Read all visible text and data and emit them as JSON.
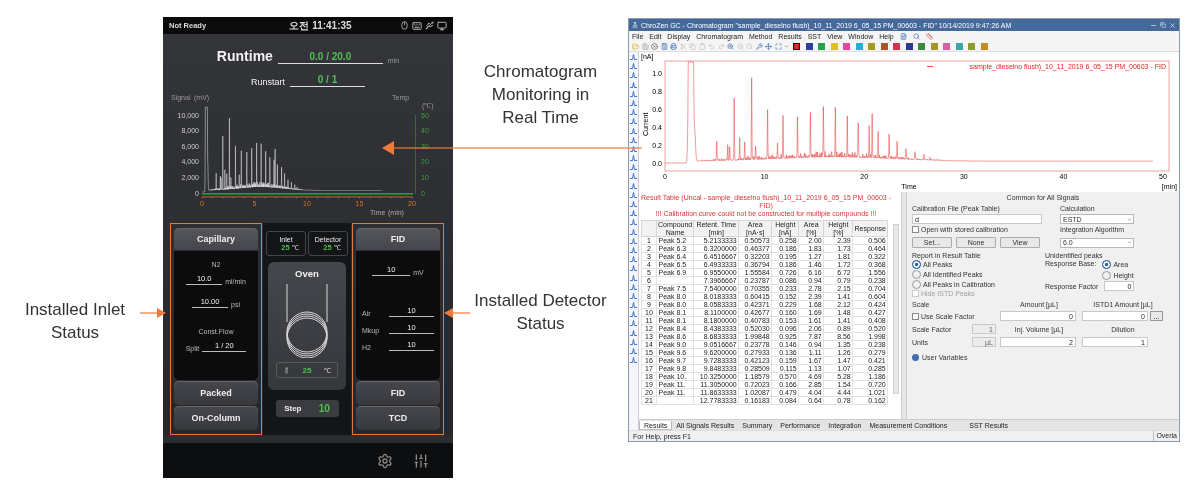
{
  "callouts": {
    "monitoring": "Chromatogram Monitoring in Real Time",
    "inlet": "Installed Inlet Status",
    "detector": "Installed Detector Status"
  },
  "device": {
    "status_bar": {
      "state": "Not Ready",
      "clock": "오전 11:41:35"
    },
    "runtime": {
      "label": "Runtime",
      "value": "0.0 / 20.0",
      "unit": "min"
    },
    "runstart": {
      "label": "Runstart",
      "value": "0 / 1"
    },
    "chart": {
      "left_title": "Signal",
      "left_unit": "(mV)",
      "right_title": "Temp",
      "right_unit": "(℃)",
      "left_ticks": [
        "10,000",
        "8,000",
        "6,000",
        "4,000",
        "2,000",
        "0"
      ],
      "right_ticks": [
        "50",
        "40",
        "30",
        "20",
        "10",
        "0"
      ],
      "x_ticks": [
        "0",
        "5",
        "10",
        "15",
        "20"
      ],
      "x_title": "Time",
      "x_unit": "(min)"
    },
    "inlet": {
      "types": [
        {
          "label": "Capillary",
          "selected": true
        },
        {
          "label": "Packed",
          "selected": false
        },
        {
          "label": "On-Column",
          "selected": false
        }
      ],
      "gas": "N2",
      "flow": "10.0",
      "flow_unit": "ml/min",
      "pressure": "10.00",
      "pressure_unit": "psi",
      "mode": "Const.Flow",
      "split_label": "Split",
      "split": "1 / 20"
    },
    "temps": [
      {
        "label": "Inlet",
        "value": "25",
        "unit": "℃"
      },
      {
        "label": "Detector",
        "value": "25",
        "unit": "℃"
      }
    ],
    "oven": {
      "label": "Oven",
      "value": "25",
      "unit": "℃"
    },
    "step": {
      "label": "Step",
      "value": "10"
    },
    "detector": {
      "types": [
        {
          "label": "FID",
          "selected": true
        },
        {
          "label": "FID",
          "selected": false
        },
        {
          "label": "TCD",
          "selected": false
        }
      ],
      "signal": "10",
      "signal_unit": "mV",
      "gases": [
        {
          "label": "Air",
          "value": "10"
        },
        {
          "label": "Mkup",
          "value": "10"
        },
        {
          "label": "H2",
          "value": "10"
        }
      ]
    }
  },
  "app": {
    "title": "ChroZen GC - Chromatogram \"sample_dieselno flush)_10_11_2019 6_05_15 PM_00603 - FID\" 10/14/2019 9:47:26 AM",
    "menu": [
      "File",
      "Edit",
      "Display",
      "Chromatogram",
      "Method",
      "Results",
      "SST",
      "View",
      "Window",
      "Help"
    ],
    "palette": [
      {
        "color": "#e32424",
        "selected": true
      },
      {
        "color": "#2b3f9e",
        "selected": false
      },
      {
        "color": "#23a34a",
        "selected": false
      },
      {
        "color": "#e0c21e",
        "selected": false
      },
      {
        "color": "#e0489e",
        "selected": false
      },
      {
        "color": "#22b0d6",
        "selected": false
      },
      {
        "color": "#a39a22",
        "selected": false
      },
      {
        "color": "#a8552a",
        "selected": false
      },
      {
        "color": "#d2344e",
        "selected": false
      },
      {
        "color": "#2f3890",
        "selected": false
      },
      {
        "color": "#3c8a3c",
        "selected": false
      },
      {
        "color": "#a8922e",
        "selected": false
      },
      {
        "color": "#d45fa4",
        "selected": false
      },
      {
        "color": "#3ea4a8",
        "selected": false
      },
      {
        "color": "#8e9a32",
        "selected": false
      },
      {
        "color": "#c58a24",
        "selected": false
      }
    ],
    "chart": {
      "y_unit": "[nA]",
      "y_title": "Current",
      "yticks": [
        "1.0",
        "0.8",
        "0.6",
        "0.4",
        "0.2",
        "0.0"
      ],
      "xticks": [
        "0",
        "10",
        "20",
        "30",
        "40",
        "50"
      ],
      "x_title": "Time",
      "x_unit": "[min]",
      "legend": "sample_dieselno flush)_10_11_2019 6_05_15 PM_00603 - FID"
    },
    "results": {
      "title": "Result Table (Uncal - sample_dieselno flush)_10_11_2019 6_05_15 PM_00603 - FID)",
      "warning": "!!! Calibration curve could not be constructed for multiple compounds !!!",
      "columns": [
        "Compound Name",
        "Retent. Time [min]",
        "Area [nA·s]",
        "Height [nA]",
        "Area [%]",
        "Height [%]",
        "Response"
      ],
      "rows": [
        {
          "no": "1",
          "name": "Peak 5.2",
          "values": [
            "5.2133333",
            "0.50573",
            "0.258",
            "2.00",
            "2.39",
            "0.506"
          ]
        },
        {
          "no": "2",
          "name": "Peak 6.3",
          "values": [
            "6.3200000",
            "0.46377",
            "0.186",
            "1.83",
            "1.73",
            "0.464"
          ]
        },
        {
          "no": "3",
          "name": "Peak 6.4",
          "values": [
            "6.4516667",
            "0.32203",
            "0.195",
            "1.27",
            "1.81",
            "0.322"
          ]
        },
        {
          "no": "4",
          "name": "Peak 6.5",
          "values": [
            "6.4933333",
            "0.36794",
            "0.186",
            "1.46",
            "1.72",
            "0.368"
          ]
        },
        {
          "no": "5",
          "name": "Peak 6.9",
          "values": [
            "6.9550000",
            "1.55584",
            "0.726",
            "6.16",
            "6.72",
            "1.556"
          ]
        },
        {
          "no": "6",
          "values": [
            "7.3966667",
            "0.23787",
            "0.086",
            "0.94",
            "0.79",
            "0.238"
          ]
        },
        {
          "no": "7",
          "name": "Peak 7.5",
          "values": [
            "7.5400000",
            "0.70355",
            "0.233",
            "2.78",
            "2.15",
            "0.704"
          ]
        },
        {
          "no": "8",
          "name": "Peak 8.0",
          "values": [
            "8.0183333",
            "0.60415",
            "0.152",
            "2.39",
            "1.41",
            "0.604"
          ]
        },
        {
          "no": "9",
          "name": "Peak 8.0",
          "values": [
            "8.0583333",
            "0.42371",
            "0.229",
            "1.68",
            "2.12",
            "0.424"
          ]
        },
        {
          "no": "10",
          "name": "Peak 8.1",
          "values": [
            "8.1100000",
            "0.42677",
            "0.160",
            "1.69",
            "1.48",
            "0.427"
          ]
        },
        {
          "no": "11",
          "name": "Peak 8.1",
          "values": [
            "8.1800000",
            "0.40783",
            "0.153",
            "1.61",
            "1.41",
            "0.408"
          ]
        },
        {
          "no": "12",
          "name": "Peak 8.4",
          "values": [
            "8.4383333",
            "0.52030",
            "0.096",
            "2.06",
            "0.89",
            "0.520"
          ]
        },
        {
          "no": "13",
          "name": "Peak 8.6",
          "values": [
            "8.6833333",
            "1.99848",
            "0.925",
            "7.87",
            "8.56",
            "1.998"
          ]
        },
        {
          "no": "14",
          "name": "Peak 9.0",
          "values": [
            "9.0516667",
            "0.23778",
            "0.146",
            "0.94",
            "1.35",
            "0.238"
          ]
        },
        {
          "no": "15",
          "name": "Peak 9.6",
          "values": [
            "9.6200000",
            "0.27933",
            "0.136",
            "1.11",
            "1.26",
            "0.279"
          ]
        },
        {
          "no": "16",
          "name": "Peak 9.7",
          "values": [
            "9.7283333",
            "0.42123",
            "0.159",
            "1.67",
            "1.47",
            "0.421"
          ]
        },
        {
          "no": "17",
          "name": "Peak 9.8",
          "values": [
            "9.8483333",
            "0.28509",
            "0.115",
            "1.13",
            "1.07",
            "0.285"
          ]
        },
        {
          "no": "18",
          "name": "Peak 10.",
          "values": [
            "10.3250000",
            "1.18579",
            "0.570",
            "4.69",
            "5.28",
            "1.186"
          ]
        },
        {
          "no": "19",
          "name": "Peak 11.",
          "values": [
            "11.3050000",
            "0.72023",
            "0.166",
            "2.85",
            "1.54",
            "0.720"
          ]
        },
        {
          "no": "20",
          "name": "Peak 11.",
          "values": [
            "11.8633333",
            "1.02087",
            "0.479",
            "4.04",
            "4.44",
            "1.021"
          ]
        },
        {
          "no": "21",
          "values": [
            "12.7783333",
            "0.16183",
            "0.084",
            "0.64",
            "0.78",
            "0.162"
          ]
        }
      ]
    },
    "settings": {
      "title": "Common for All Signals",
      "calibration_label": "Calibration File (Peak Table)",
      "calibration_value": "d",
      "open_stored": {
        "label": "Open with stored calibration",
        "checked": false
      },
      "buttons": [
        "Set...",
        "None",
        "View"
      ],
      "calculation_label": "Calculation",
      "calculation_value": "ESTD",
      "algorithm_label": "Integration Algorithm",
      "algorithm_value": "6.0",
      "report_label": "Report in Result Table",
      "report_options": [
        {
          "label": "All Peaks",
          "selected": true
        },
        {
          "label": "All Identified Peaks",
          "selected": false
        },
        {
          "label": "All Peaks in Calibration",
          "selected": false
        }
      ],
      "hide_istd": {
        "label": "Hide ISTD Peaks",
        "checked": false,
        "disabled": true
      },
      "unidentified_label": "Unidentified peaks",
      "response_base_label": "Response Base:",
      "response_base": [
        {
          "label": "Area",
          "selected": true
        },
        {
          "label": "Height",
          "selected": false
        }
      ],
      "response_factor_label": "Response Factor",
      "response_factor": "0",
      "scale_label": "Scale",
      "use_scale": {
        "label": "Use Scale Factor",
        "checked": false
      },
      "scale_factor": {
        "label": "Scale Factor",
        "value": "1",
        "disabled": true
      },
      "units": {
        "label": "Units",
        "value": "µL",
        "disabled": true
      },
      "amount": {
        "label": "Amount [µL]",
        "value": "0"
      },
      "istd_amount": {
        "label": "ISTD1 Amount [µL]",
        "value": "0"
      },
      "more_button": "...",
      "inj_volume": {
        "label": "Inj. Volume [µL]",
        "value": "2"
      },
      "dilution": {
        "label": "Dilution",
        "value": "1"
      },
      "user_variables": "User Variables"
    },
    "bottom_tabs": [
      {
        "label": "Results",
        "selected": true
      },
      {
        "label": "All Signals Results",
        "selected": false
      },
      {
        "label": "Summary",
        "selected": false
      },
      {
        "label": "Performance",
        "selected": false
      },
      {
        "label": "Integration",
        "selected": false
      },
      {
        "label": "Measurement Conditions",
        "selected": false
      },
      {
        "label": "SST Results",
        "selected": false
      }
    ],
    "status": "For Help, press F1",
    "status_pane": "Overla"
  }
}
